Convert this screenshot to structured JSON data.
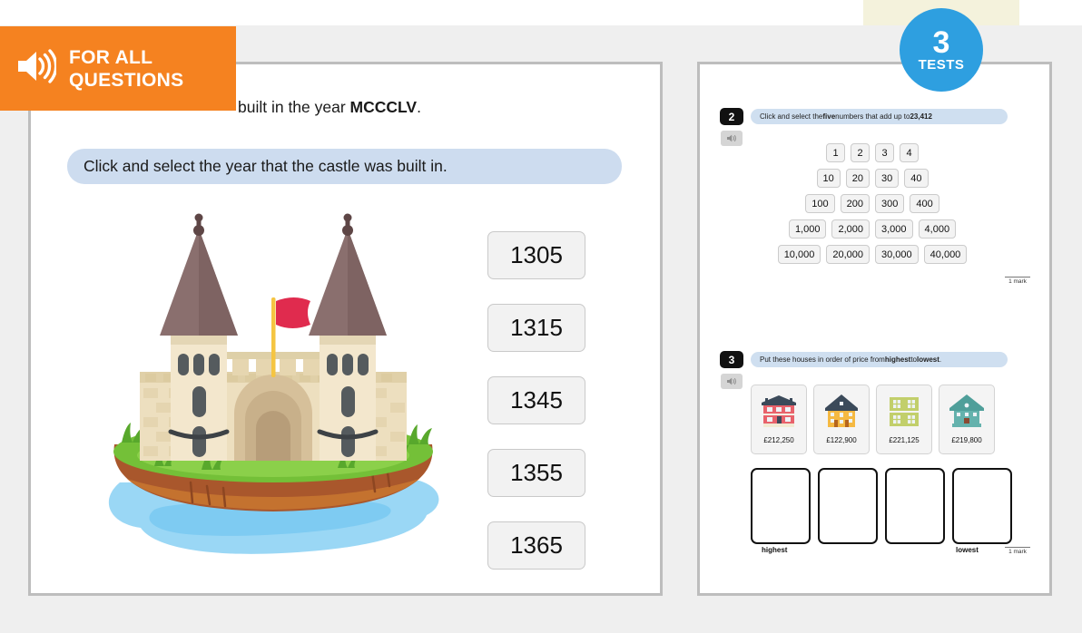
{
  "background": {
    "page_bg": "#efefef",
    "accent_orange": "#f58220",
    "badge_blue": "#2e9fe0",
    "instruction_blue": "#cddcef"
  },
  "audio_banner": {
    "icon": "speaker-icon",
    "line1": "FOR ALL",
    "line2": "QUESTIONS"
  },
  "badge": {
    "count": "3",
    "label": "TESTS"
  },
  "left_panel": {
    "stem_prefix": "built in the year ",
    "stem_bold": "MCCCLV",
    "stem_suffix": ".",
    "instruction": "Click and select the year that the castle was built in.",
    "illustration": "castle-illustration",
    "options": [
      "1305",
      "1315",
      "1345",
      "1355",
      "1365"
    ]
  },
  "right_panel": {
    "questions": [
      {
        "number": "2",
        "speaker_icon": "speaker-icon",
        "prompt_parts": [
          {
            "text": "Click and select the ",
            "bold": false
          },
          {
            "text": "five",
            "bold": true
          },
          {
            "text": " numbers that add up to ",
            "bold": false
          },
          {
            "text": "23,412",
            "bold": true
          }
        ],
        "mark": "1 mark",
        "number_grid": [
          [
            "1",
            "2",
            "3",
            "4"
          ],
          [
            "10",
            "20",
            "30",
            "40"
          ],
          [
            "100",
            "200",
            "300",
            "400"
          ],
          [
            "1,000",
            "2,000",
            "3,000",
            "4,000"
          ],
          [
            "10,000",
            "20,000",
            "30,000",
            "40,000"
          ]
        ]
      },
      {
        "number": "3",
        "speaker_icon": "speaker-icon",
        "prompt_parts": [
          {
            "text": "Put these houses in order of price from ",
            "bold": false
          },
          {
            "text": "highest",
            "bold": true
          },
          {
            "text": " to ",
            "bold": false
          },
          {
            "text": "lowest",
            "bold": true
          },
          {
            "text": ".",
            "bold": false
          }
        ],
        "mark": "1 mark",
        "houses": [
          {
            "price": "£212,250",
            "color": "#e8626b",
            "roof": "#3b4a5a",
            "icon": "house-icon"
          },
          {
            "price": "£122,900",
            "color": "#f5b942",
            "roof": "#3b4a5a",
            "icon": "house-icon"
          },
          {
            "price": "£221,125",
            "color": "#c2cf6b",
            "roof": "#c2cf6b",
            "icon": "house-icon"
          },
          {
            "price": "£219,800",
            "color": "#64b2ad",
            "roof": "#4f9f9a",
            "icon": "house-icon"
          }
        ],
        "drop_boxes": 4,
        "label_highest": "highest",
        "label_lowest": "lowest"
      }
    ]
  }
}
